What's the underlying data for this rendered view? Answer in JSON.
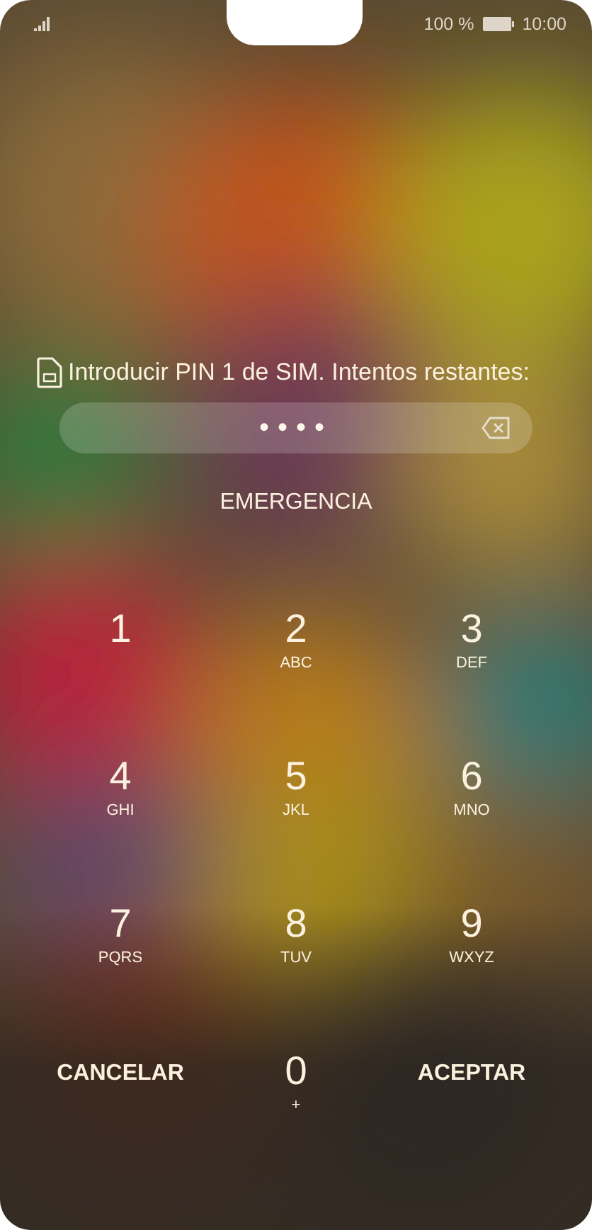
{
  "status_bar": {
    "battery": "100 %",
    "time": "10:00"
  },
  "prompt": "Introducir PIN 1 de SIM. Intentos restantes:",
  "pin_field": {
    "value": "••••"
  },
  "emergency": "EMERGENCIA",
  "keys": [
    {
      "kind": "digit",
      "digit": "1"
    },
    {
      "kind": "digit",
      "digit": "2",
      "letters": "ABC"
    },
    {
      "kind": "digit",
      "digit": "3",
      "letters": "DEF"
    },
    {
      "kind": "digit",
      "digit": "4",
      "letters": "GHI"
    },
    {
      "kind": "digit",
      "digit": "5",
      "letters": "JKL"
    },
    {
      "kind": "digit",
      "digit": "6",
      "letters": "MNO"
    },
    {
      "kind": "digit",
      "digit": "7",
      "letters": "PQRS"
    },
    {
      "kind": "digit",
      "digit": "8",
      "letters": "TUV"
    },
    {
      "kind": "digit",
      "digit": "9",
      "letters": "WXYZ"
    },
    {
      "kind": "action",
      "label": "CANCELAR"
    },
    {
      "kind": "digit",
      "digit": "0",
      "letters": "+"
    },
    {
      "kind": "action",
      "label": "ACEPTAR"
    }
  ]
}
